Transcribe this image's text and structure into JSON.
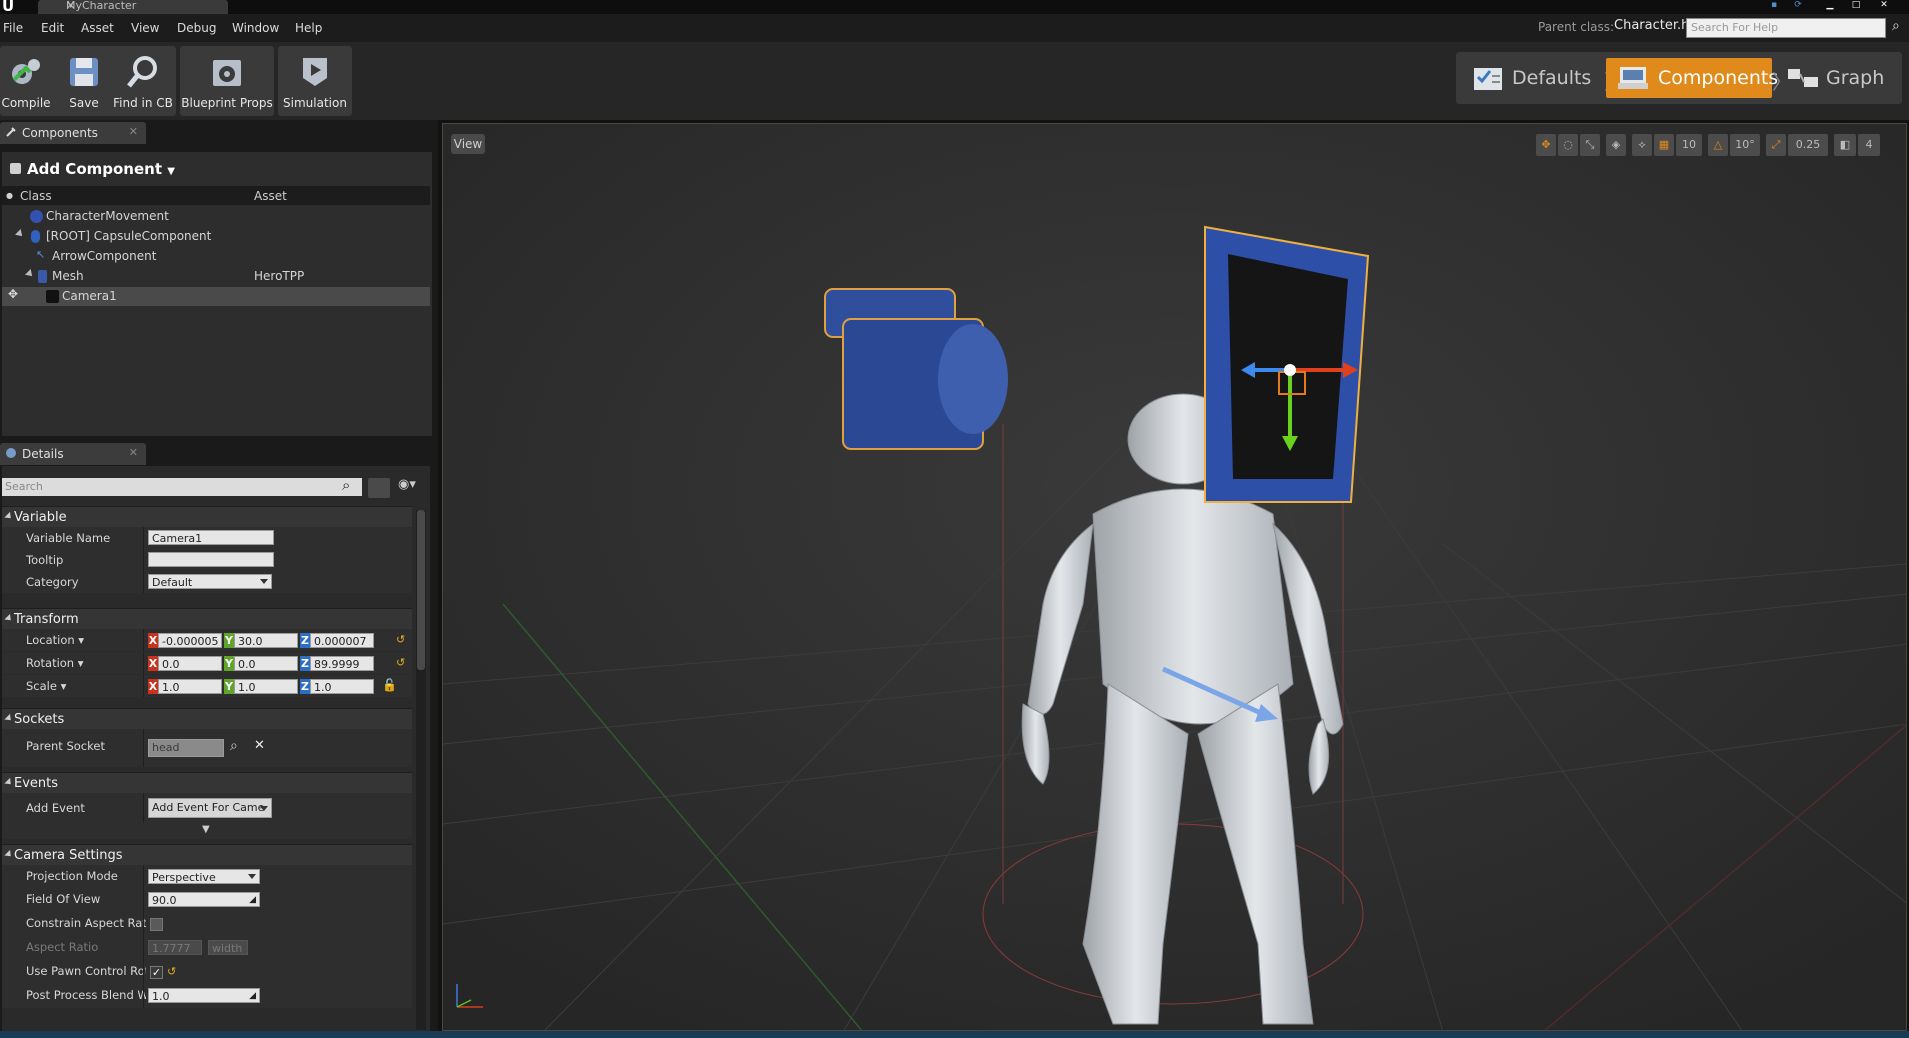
{
  "window": {
    "tab_title": "MyCharacter",
    "logo": "U"
  },
  "menu": [
    "File",
    "Edit",
    "Asset",
    "View",
    "Debug",
    "Window",
    "Help"
  ],
  "header": {
    "parent_class_label": "Parent class:",
    "parent_class_value": "Character.h",
    "help_search_placeholder": "Search For Help"
  },
  "toolbar": {
    "buttons": [
      {
        "label": "Compile",
        "icon": "compile-gear-icon"
      },
      {
        "label": "Save",
        "icon": "save-disk-icon"
      },
      {
        "label": "Find in CB",
        "icon": "magnifier-icon"
      },
      {
        "label": "Blueprint Props",
        "icon": "blueprint-gear-icon"
      },
      {
        "label": "Simulation",
        "icon": "simulation-icon"
      }
    ]
  },
  "modes": {
    "items": [
      {
        "label": "Defaults",
        "icon": "checklist-icon",
        "active": false
      },
      {
        "label": "Components",
        "icon": "components-icon",
        "active": true
      },
      {
        "label": "Graph",
        "icon": "graph-icon",
        "active": false
      }
    ]
  },
  "components_panel": {
    "tab_label": "Components",
    "add_component_label": "Add Component",
    "col_class": "Class",
    "col_asset": "Asset",
    "rows": [
      {
        "name": "CharacterMovement",
        "asset": ""
      },
      {
        "name": "[ROOT] CapsuleComponent",
        "asset": ""
      },
      {
        "name": "ArrowComponent",
        "asset": ""
      },
      {
        "name": "Mesh",
        "asset": "HeroTPP"
      },
      {
        "name": "Camera1",
        "asset": ""
      }
    ]
  },
  "details_panel": {
    "tab_label": "Details",
    "search_placeholder": "Search",
    "variable": {
      "header": "Variable",
      "name_label": "Variable Name",
      "name_value": "Camera1",
      "tooltip_label": "Tooltip",
      "tooltip_value": "",
      "category_label": "Category",
      "category_value": "Default"
    },
    "transform": {
      "header": "Transform",
      "location_label": "Location",
      "location": {
        "x": "-0.000005",
        "y": "30.0",
        "z": "0.000007"
      },
      "rotation_label": "Rotation",
      "rotation": {
        "x": "0.0",
        "y": "0.0",
        "z": "89.9999"
      },
      "scale_label": "Scale",
      "scale": {
        "x": "1.0",
        "y": "1.0",
        "z": "1.0"
      }
    },
    "sockets": {
      "header": "Sockets",
      "parent_socket_label": "Parent Socket",
      "parent_socket_value": "head"
    },
    "events": {
      "header": "Events",
      "add_event_label": "Add Event",
      "add_event_button": "Add Event For Came"
    },
    "camera": {
      "header": "Camera Settings",
      "projection_label": "Projection Mode",
      "projection_value": "Perspective",
      "fov_label": "Field Of View",
      "fov_value": "90.0",
      "constrain_label": "Constrain Aspect Ratio",
      "constrain_checked": false,
      "aspect_label": "Aspect Ratio",
      "aspect_value": "1.7777",
      "aspect_mode": "width",
      "pawn_label": "Use Pawn Control Rotat",
      "pawn_checked": true,
      "blend_label": "Post Process Blend We",
      "blend_value": "1.0"
    }
  },
  "viewport": {
    "view_button": "View",
    "grid_snap": "10",
    "rot_snap": "10°",
    "scale_snap": "0.25",
    "cam_speed": "4"
  },
  "axis_labels": {
    "x": "X",
    "y": "Y",
    "z": "Z"
  },
  "colors": {
    "accent": "#e08a1c",
    "x_axis": "#c8321e",
    "y_axis": "#5fa52a",
    "z_axis": "#2a6ec8"
  }
}
